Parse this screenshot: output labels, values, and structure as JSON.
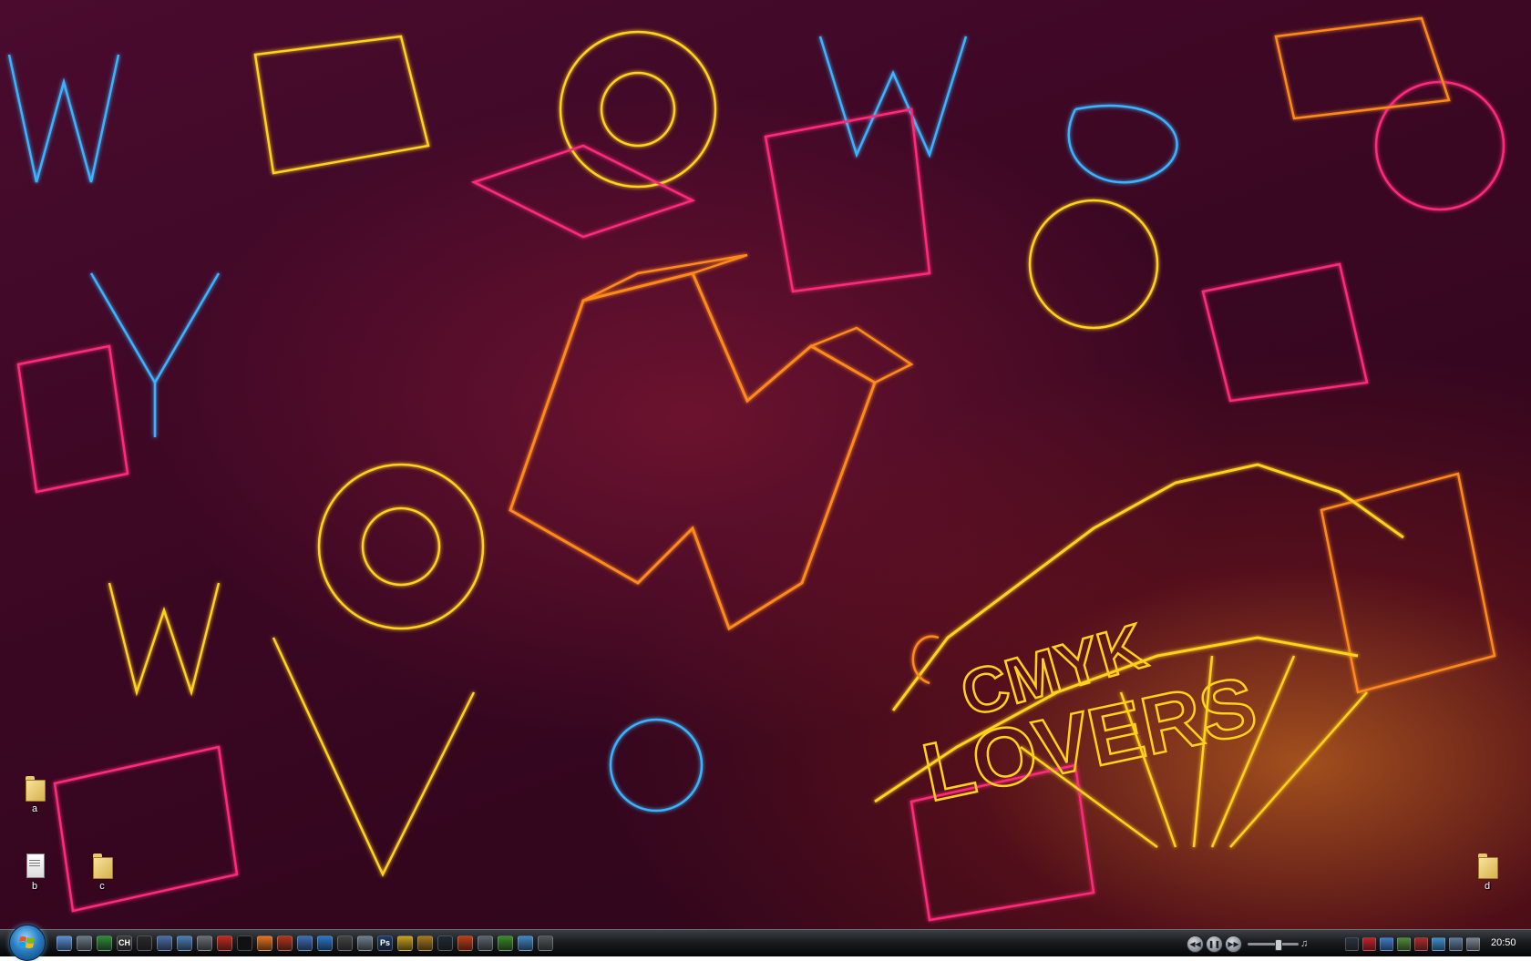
{
  "desktop": {
    "icons": [
      {
        "label": "a",
        "type": "folder"
      },
      {
        "label": "b",
        "type": "document"
      },
      {
        "label": "c",
        "type": "folder"
      },
      {
        "label": "d",
        "type": "folder"
      }
    ],
    "wallpaper": {
      "text_main": "CMYK",
      "text_sub": "LOVERS",
      "colors": {
        "yellow": "#ffd21a",
        "orange": "#ff8a1a",
        "pink": "#ff2a7a",
        "cyan": "#3ab4ff",
        "bg": "#3a0722"
      }
    }
  },
  "taskbar": {
    "start_button_icon": "windows-logo-icon",
    "quick_launch": [
      {
        "icon": "show-desktop-icon",
        "label": "",
        "color": "#5a8fd6"
      },
      {
        "icon": "tools-icon",
        "label": "",
        "color": "#6b7a86"
      },
      {
        "icon": "spreadsheet-icon",
        "label": "",
        "color": "#2e8b3a"
      },
      {
        "icon": "ch-icon",
        "label": "CH",
        "color": "#3c3c3c"
      },
      {
        "icon": "runner-icon",
        "label": "",
        "color": "#2a2a2a"
      },
      {
        "icon": "globe-icon",
        "label": "",
        "color": "#4c6ea8"
      },
      {
        "icon": "paint-icon",
        "label": "",
        "color": "#4a7fb8"
      },
      {
        "icon": "drop-icon",
        "label": "",
        "color": "#6a6f75"
      },
      {
        "icon": "filezilla-icon",
        "label": "",
        "color": "#c7281e"
      },
      {
        "icon": "terminal-icon",
        "label": "",
        "color": "#111111"
      },
      {
        "icon": "firefox-icon",
        "label": "",
        "color": "#e8731c"
      },
      {
        "icon": "media-icon",
        "label": "",
        "color": "#b8331a"
      },
      {
        "icon": "app-icon",
        "label": "",
        "color": "#3b6fb6"
      },
      {
        "icon": "orb-icon",
        "label": "",
        "color": "#2a78c9"
      },
      {
        "icon": "skull-icon",
        "label": "",
        "color": "#444444"
      },
      {
        "icon": "recycle-icon",
        "label": "",
        "color": "#6e7f8c"
      },
      {
        "icon": "photoshop-icon",
        "label": "Ps",
        "color": "#1b3c6a"
      },
      {
        "icon": "radiation-icon",
        "label": "",
        "color": "#c8a21a"
      },
      {
        "icon": "hazard-icon",
        "label": "",
        "color": "#a8781a"
      },
      {
        "icon": "steam-icon",
        "label": "",
        "color": "#1f2a36"
      },
      {
        "icon": "fire-icon",
        "label": "",
        "color": "#c23a14"
      },
      {
        "icon": "disc-icon",
        "label": "",
        "color": "#5d6570"
      },
      {
        "icon": "alien-icon",
        "label": "",
        "color": "#3a8a2a"
      },
      {
        "icon": "network-icon",
        "label": "",
        "color": "#3f87c7"
      },
      {
        "icon": "mail-icon",
        "label": "",
        "color": "#50565c"
      }
    ],
    "media": {
      "prev_icon": "previous-icon",
      "pause_icon": "pause-icon",
      "next_icon": "next-icon",
      "volume": 0.6,
      "speaker_icon": "speaker-icon"
    },
    "tray": [
      {
        "icon": "steam-tray-icon",
        "color": "#2a3440"
      },
      {
        "icon": "antivirus-tray-icon",
        "color": "#c4202a"
      },
      {
        "icon": "network-tray-icon",
        "color": "#3d7cc9"
      },
      {
        "icon": "app-tray-icon",
        "color": "#4f8a3a"
      },
      {
        "icon": "close-tray-icon",
        "color": "#b02a2a"
      },
      {
        "icon": "sync-tray-icon",
        "color": "#3b8fd0"
      },
      {
        "icon": "monitor-tray-icon",
        "color": "#5d7a96"
      },
      {
        "icon": "volume-tray-icon",
        "color": "#7a8590"
      }
    ],
    "clock": "20:50"
  }
}
